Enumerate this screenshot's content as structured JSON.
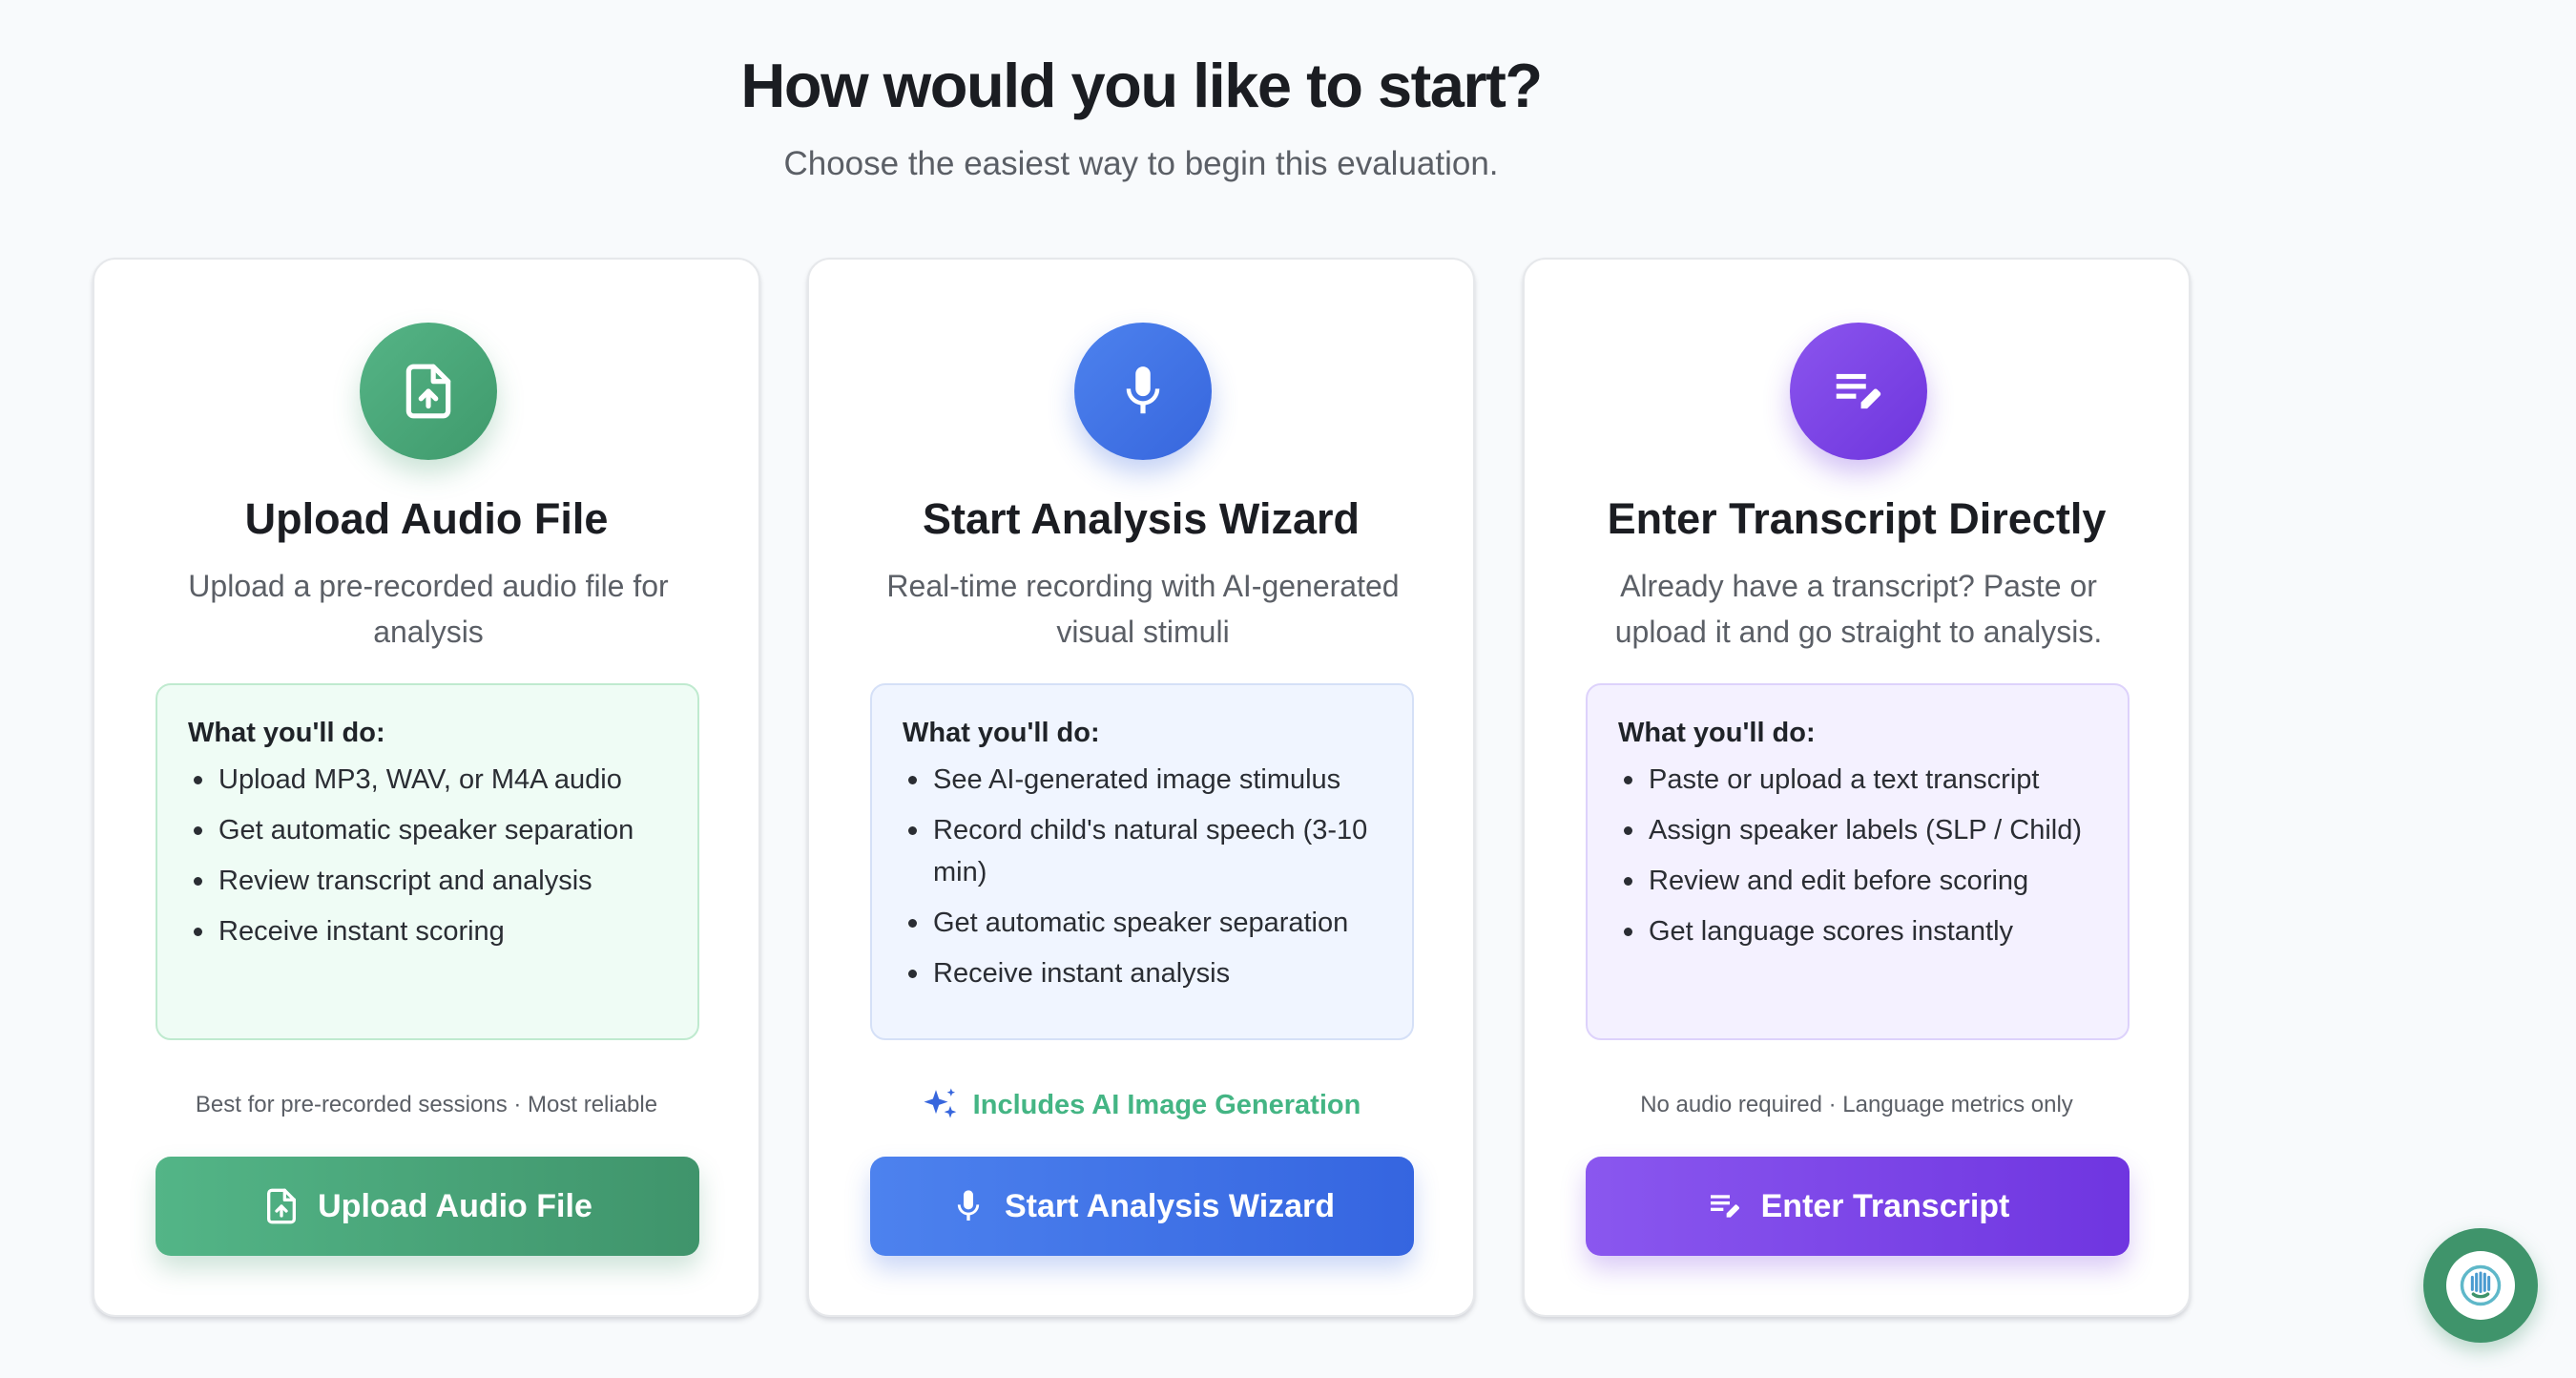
{
  "header": {
    "title": "How would you like to start?",
    "subtitle": "Choose the easiest way to begin this evaluation."
  },
  "cards": [
    {
      "icon": "file-upload-icon",
      "title": "Upload Audio File",
      "description": "Upload a pre-recorded audio file for analysis",
      "box_title": "What you'll do:",
      "items": [
        "Upload MP3, WAV, or M4A audio",
        "Get automatic speaker separation",
        "Review transcript and analysis",
        "Receive instant scoring"
      ],
      "note": "Best for pre-recorded sessions · Most reliable",
      "button_label": "Upload Audio File",
      "accent": "#3f9a6c"
    },
    {
      "icon": "microphone-icon",
      "title": "Start Analysis Wizard",
      "description": "Real-time recording with AI-generated visual stimuli",
      "box_title": "What you'll do:",
      "items": [
        "See AI-generated image stimulus",
        "Record child's natural speech (3-10 min)",
        "Get automatic speaker separation",
        "Receive instant analysis"
      ],
      "note": "Includes AI Image Generation",
      "button_label": "Start Analysis Wizard",
      "accent": "#3766dd"
    },
    {
      "icon": "edit-note-icon",
      "title": "Enter Transcript Directly",
      "description": "Already have a transcript? Paste or upload it and go straight to analysis.",
      "box_title": "What you'll do:",
      "items": [
        "Paste or upload a text transcript",
        "Assign speaker labels (SLP / Child)",
        "Review and edit before scoring",
        "Get language scores instantly"
      ],
      "note": "No audio required · Language metrics only",
      "button_label": "Enter Transcript",
      "accent": "#6e35dd"
    }
  ],
  "fab": {
    "icon": "assistant-icon",
    "color": "#3f946b"
  }
}
